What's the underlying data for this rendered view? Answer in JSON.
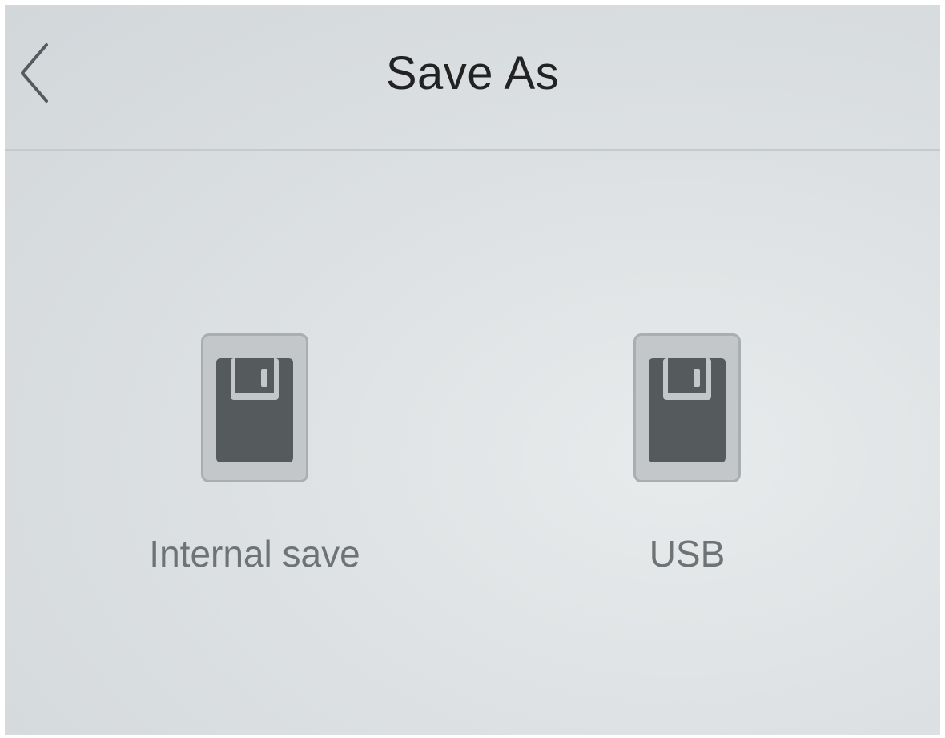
{
  "header": {
    "title": "Save As",
    "back_icon": "chevron-left-icon"
  },
  "options": [
    {
      "label": "Internal save",
      "icon": "floppy-disk-icon"
    },
    {
      "label": "USB",
      "icon": "floppy-disk-icon"
    }
  ],
  "colors": {
    "background": "#dde1e3",
    "title_text": "#222222",
    "label_text": "#6e7376",
    "icon_tile": "#c3c7c9",
    "icon_fill": "#555a5d"
  }
}
